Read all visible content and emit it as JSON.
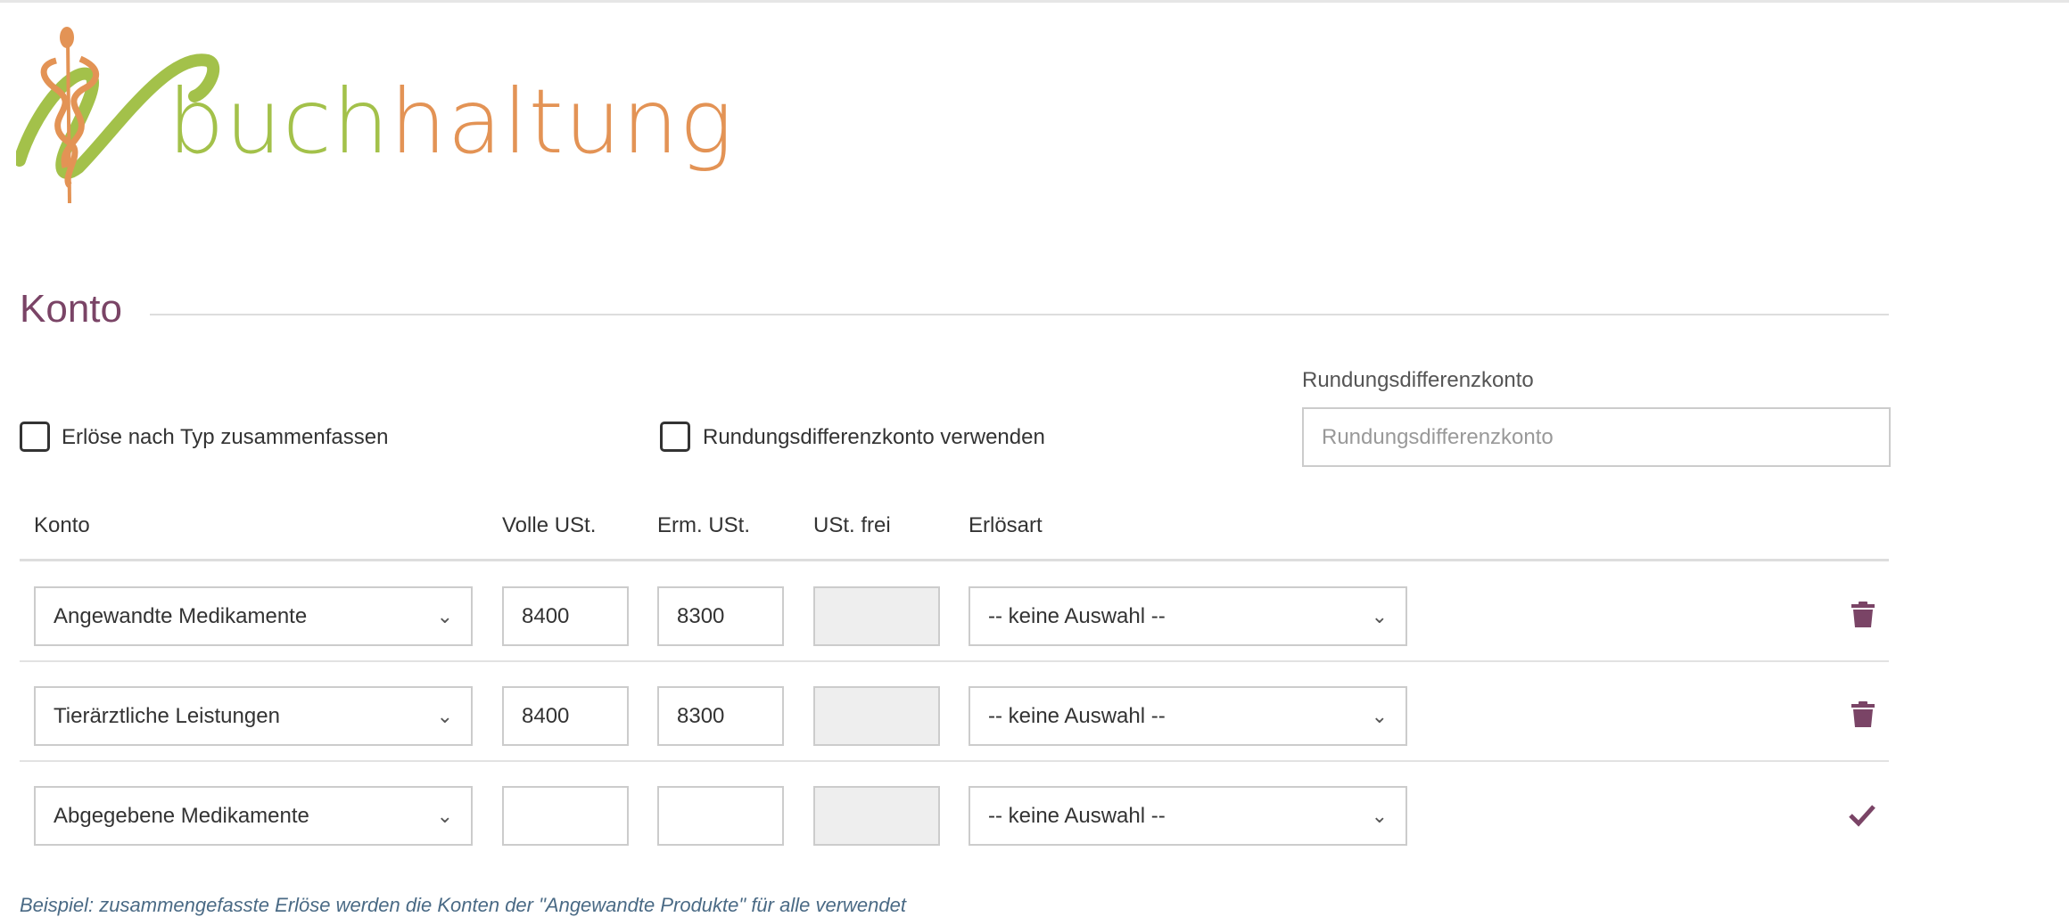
{
  "brand": {
    "logo_text_part1": "buch",
    "logo_text_part2": "h",
    "logo_text_part3": "altung",
    "green": "#a3c14a",
    "orange": "#e39355"
  },
  "colors": {
    "accent": "#7a4466",
    "note": "#4a6a85"
  },
  "section": {
    "title": "Konto"
  },
  "options": {
    "merge_label": "Erlöse nach Typ zusammenfassen",
    "merge_checked": false,
    "rounding_label": "Rundungsdifferenzkonto verwenden",
    "rounding_checked": false,
    "rounding_account_label": "Rundungsdifferenzkonto",
    "rounding_account_placeholder": "Rundungsdifferenzkonto",
    "rounding_account_value": ""
  },
  "table": {
    "headers": [
      "Konto",
      "Volle USt.",
      "Erm. USt.",
      "USt. frei",
      "Erlösart"
    ],
    "rows": [
      {
        "konto": "Angewandte Medikamente",
        "volle": "8400",
        "erm": "8300",
        "frei": "",
        "erloesart": "-- keine Auswahl --",
        "action": "trash-icon"
      },
      {
        "konto": "Tierärztliche Leistungen",
        "volle": "8400",
        "erm": "8300",
        "frei": "",
        "erloesart": "-- keine Auswahl --",
        "action": "trash-icon"
      },
      {
        "konto": "Abgegebene Medikamente",
        "volle": "",
        "erm": "",
        "frei": "",
        "erloesart": "-- keine Auswahl --",
        "action": "check-icon"
      }
    ]
  },
  "note": "Beispiel: zusammengefasste Erlöse werden die Konten der \"Angewandte Produkte\" für alle verwendet"
}
